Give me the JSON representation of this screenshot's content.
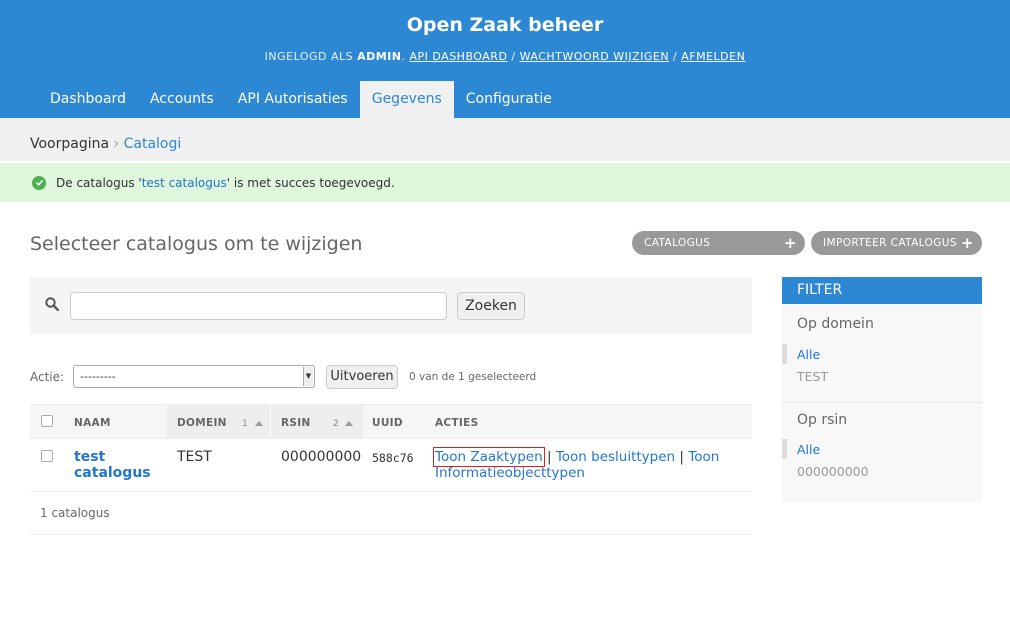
{
  "header": {
    "branding": "Open Zaak beheer",
    "user_tools": {
      "prefix": "INGELOGD ALS",
      "username": "ADMIN",
      "links": [
        "API DASHBOARD",
        "WACHTWOORD WIJZIGEN",
        "AFMELDEN"
      ]
    },
    "nav": [
      {
        "label": "Dashboard"
      },
      {
        "label": "Accounts"
      },
      {
        "label": "API Autorisaties"
      },
      {
        "label": "Gegevens",
        "active": true
      },
      {
        "label": "Configuratie"
      }
    ]
  },
  "breadcrumbs": {
    "home": "Voorpagina",
    "separator": "›",
    "current": "Catalogi"
  },
  "message": {
    "prefix": "De catalogus '",
    "link": "test catalogus",
    "suffix": "' is met succes toegevoegd.",
    "type": "success"
  },
  "page": {
    "title": "Selecteer catalogus om te wijzigen",
    "object_tools": [
      "CATALOGUS TOEVOEGEN",
      "IMPORTEER CATALOGUS"
    ]
  },
  "search": {
    "value": "",
    "button": "Zoeken"
  },
  "actions": {
    "label": "Actie:",
    "selected": "---------",
    "run_button": "Uitvoeren",
    "counter": "0 van de 1 geselecteerd"
  },
  "table": {
    "columns": [
      "NAAM",
      "DOMEIN",
      "RSIN",
      "UUID",
      "ACTIES"
    ],
    "sort_numbers": [
      "1",
      "2"
    ],
    "rows": [
      {
        "name_line1": "test",
        "name_line2": "catalogus",
        "domein": "TEST",
        "rsin": "000000000",
        "uuid": "588c76",
        "actions": [
          "Toon Zaaktypen",
          "Toon besluittypen",
          "Toon",
          "Informatieobjecttypen"
        ],
        "separator": "|"
      }
    ],
    "paginator": "1 catalogus"
  },
  "filter": {
    "header": "FILTER",
    "groups": [
      {
        "title": "Op domein",
        "options": [
          "Alle",
          "TEST"
        ]
      },
      {
        "title": "Op rsin",
        "options": [
          "Alle",
          "000000000"
        ]
      }
    ]
  },
  "colors": {
    "header": "#2d88d3",
    "link": "#2277cc",
    "success_bg": "#dff6dd",
    "highlight": "#e02020"
  }
}
